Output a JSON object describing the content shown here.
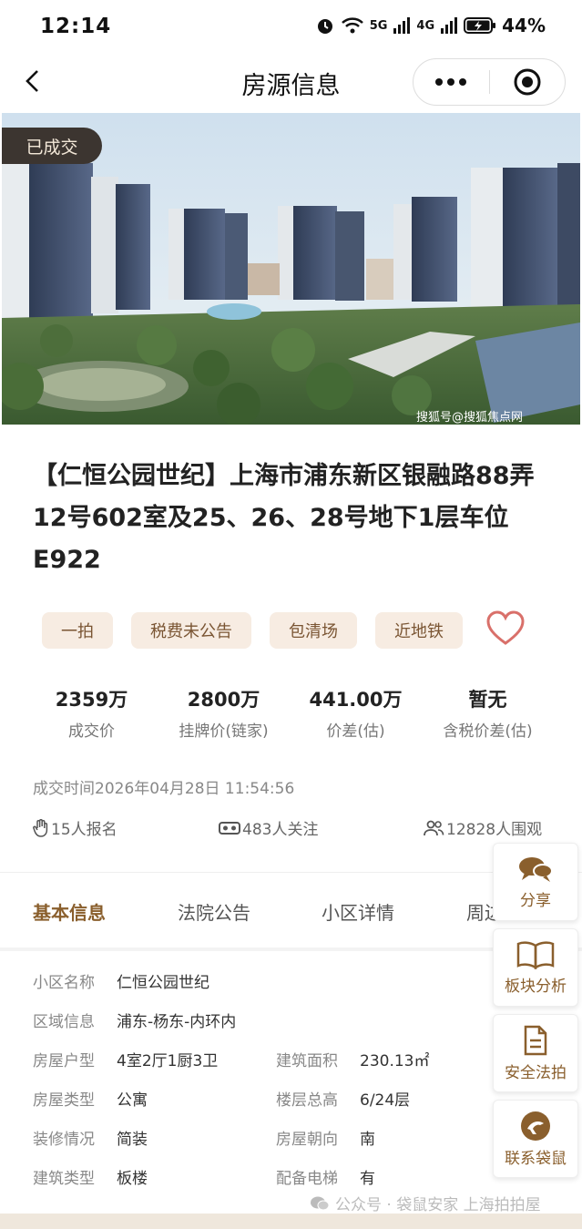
{
  "status_bar": {
    "time": "12:14",
    "battery": "44%",
    "signal1": "5G",
    "signal2": "4G"
  },
  "nav": {
    "title": "房源信息"
  },
  "hero": {
    "badge": "已成交",
    "caption": "搜狐号@搜狐焦点网"
  },
  "property": {
    "title": "【仁恒公园世纪】上海市浦东新区银融路88弄12号602室及25、26、28号地下1层车位E922",
    "tags": [
      "一拍",
      "税费未公告",
      "包清场",
      "近地铁"
    ]
  },
  "stats": [
    {
      "value": "2359万",
      "label": "成交价"
    },
    {
      "value": "2800万",
      "label": "挂牌价(链家)"
    },
    {
      "value": "441.00万",
      "label": "价差(估)"
    },
    {
      "value": "暂无",
      "label": "含税价差(估)"
    }
  ],
  "deal_time": "成交时间2026年04月28日 11:54:56",
  "counts": {
    "signup": "15人报名",
    "follow": "483人关注",
    "watch": "12828人围观"
  },
  "tabs": [
    "基本信息",
    "法院公告",
    "小区详情",
    "周边"
  ],
  "info": {
    "rows": [
      [
        {
          "k": "小区名称",
          "v": "仁恒公园世纪"
        }
      ],
      [
        {
          "k": "区域信息",
          "v": "浦东-杨东-内环内"
        }
      ],
      [
        {
          "k": "房屋户型",
          "v": "4室2厅1厨3卫"
        },
        {
          "k": "建筑面积",
          "v": "230.13㎡"
        }
      ],
      [
        {
          "k": "房屋类型",
          "v": "公寓"
        },
        {
          "k": "楼层总高",
          "v": "6/24层"
        }
      ],
      [
        {
          "k": "装修情况",
          "v": "简装"
        },
        {
          "k": "房屋朝向",
          "v": "南"
        }
      ],
      [
        {
          "k": "建筑类型",
          "v": "板楼"
        },
        {
          "k": "配备电梯",
          "v": "有"
        }
      ]
    ]
  },
  "side_buttons": {
    "share": "分享",
    "analysis": "板块分析",
    "safe": "安全法拍",
    "contact": "联系袋鼠"
  },
  "watermark": "公众号 · 袋鼠安家 上海拍拍屋",
  "colors": {
    "accent": "#8a5f2d",
    "tag_bg": "#f7ece2",
    "heart": "#d9706a"
  }
}
